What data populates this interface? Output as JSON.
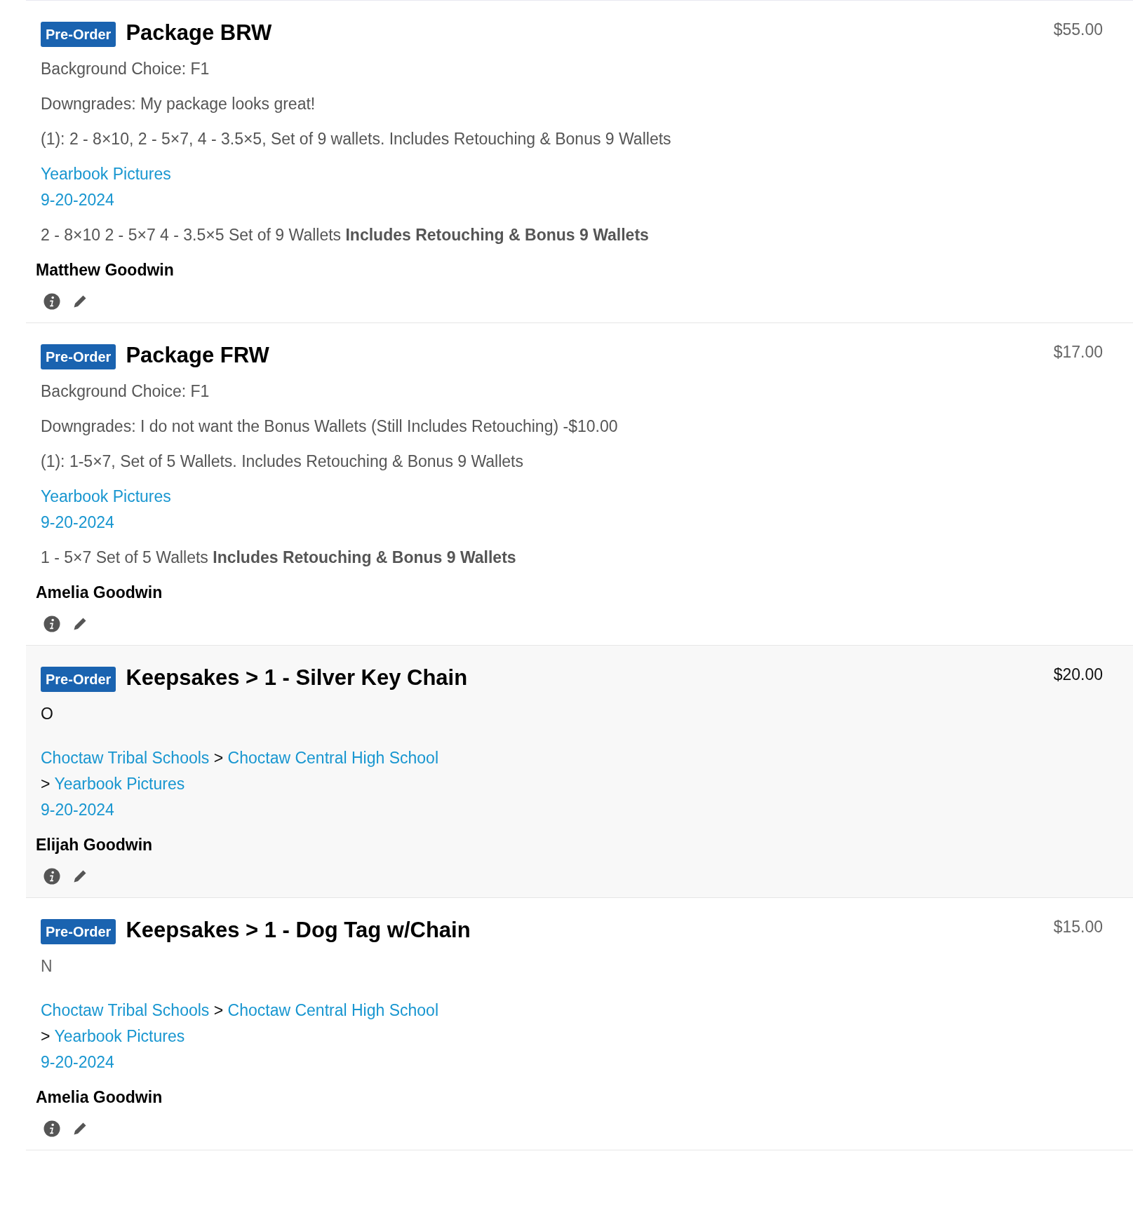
{
  "items": [
    {
      "badge": "Pre-Order",
      "title": "Package BRW",
      "price": "$55.00",
      "highlighted": false,
      "lines": [
        "Background Choice: F1",
        "Downgrades: My package looks great!",
        "(1): 2 - 8×10, 2 - 5×7, 4 - 3.5×5, Set of 9 wallets. Includes Retouching & Bonus 9 Wallets"
      ],
      "breadcrumb": [
        {
          "kind": "link",
          "text": "Yearbook Pictures"
        }
      ],
      "date": "9-20-2024",
      "description": "2 - 8×10 2 - 5×7 4 - 3.5×5 Set of 9 Wallets **Includes Retouching & Bonus 9 Wallets**",
      "name": "Matthew Goodwin"
    },
    {
      "badge": "Pre-Order",
      "title": "Package FRW",
      "price": "$17.00",
      "highlighted": false,
      "lines": [
        "Background Choice: F1",
        "Downgrades: I do not want the Bonus Wallets (Still Includes Retouching) -$10.00",
        "(1): 1-5×7, Set of 5 Wallets. Includes Retouching & Bonus 9 Wallets"
      ],
      "breadcrumb": [
        {
          "kind": "link",
          "text": "Yearbook Pictures"
        }
      ],
      "date": "9-20-2024",
      "description": "1 - 5×7 Set of 5 Wallets **Includes Retouching & Bonus 9 Wallets**",
      "name": "Amelia Goodwin"
    },
    {
      "badge": "Pre-Order",
      "title": "Keepsakes > 1 - Silver Key Chain",
      "price": "$20.00",
      "highlighted": true,
      "note": "O",
      "breadcrumb": [
        {
          "kind": "link",
          "text": "Choctaw Tribal Schools"
        },
        {
          "kind": "sep",
          "text": ">"
        },
        {
          "kind": "link",
          "text": "Choctaw Central High School"
        },
        {
          "kind": "sep",
          "text": ">"
        },
        {
          "kind": "link",
          "text": "Yearbook Pictures"
        }
      ],
      "date": "9-20-2024",
      "name": "Elijah Goodwin"
    },
    {
      "badge": "Pre-Order",
      "title": "Keepsakes > 1 - Dog Tag w/Chain",
      "price": "$15.00",
      "highlighted": false,
      "note": "N",
      "breadcrumb": [
        {
          "kind": "link",
          "text": "Choctaw Tribal Schools"
        },
        {
          "kind": "sep",
          "text": ">"
        },
        {
          "kind": "link",
          "text": "Choctaw Central High School"
        },
        {
          "kind": "sep",
          "text": ">"
        },
        {
          "kind": "link",
          "text": "Yearbook Pictures"
        }
      ],
      "date": "9-20-2024",
      "name": "Amelia Goodwin"
    }
  ]
}
